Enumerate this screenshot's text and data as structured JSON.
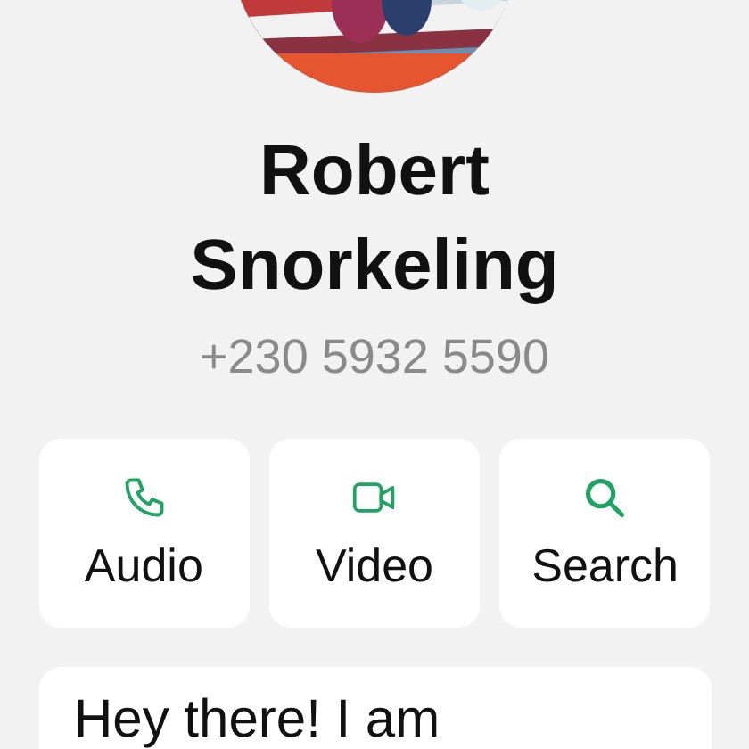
{
  "profile": {
    "name": "Robert Snorkeling",
    "phone": "+230 5932 5590"
  },
  "actions": [
    {
      "kind": "audio",
      "label": "Audio"
    },
    {
      "kind": "video",
      "label": "Video"
    },
    {
      "kind": "search",
      "label": "Search"
    }
  ],
  "about": {
    "text": "Hey there! I am"
  }
}
